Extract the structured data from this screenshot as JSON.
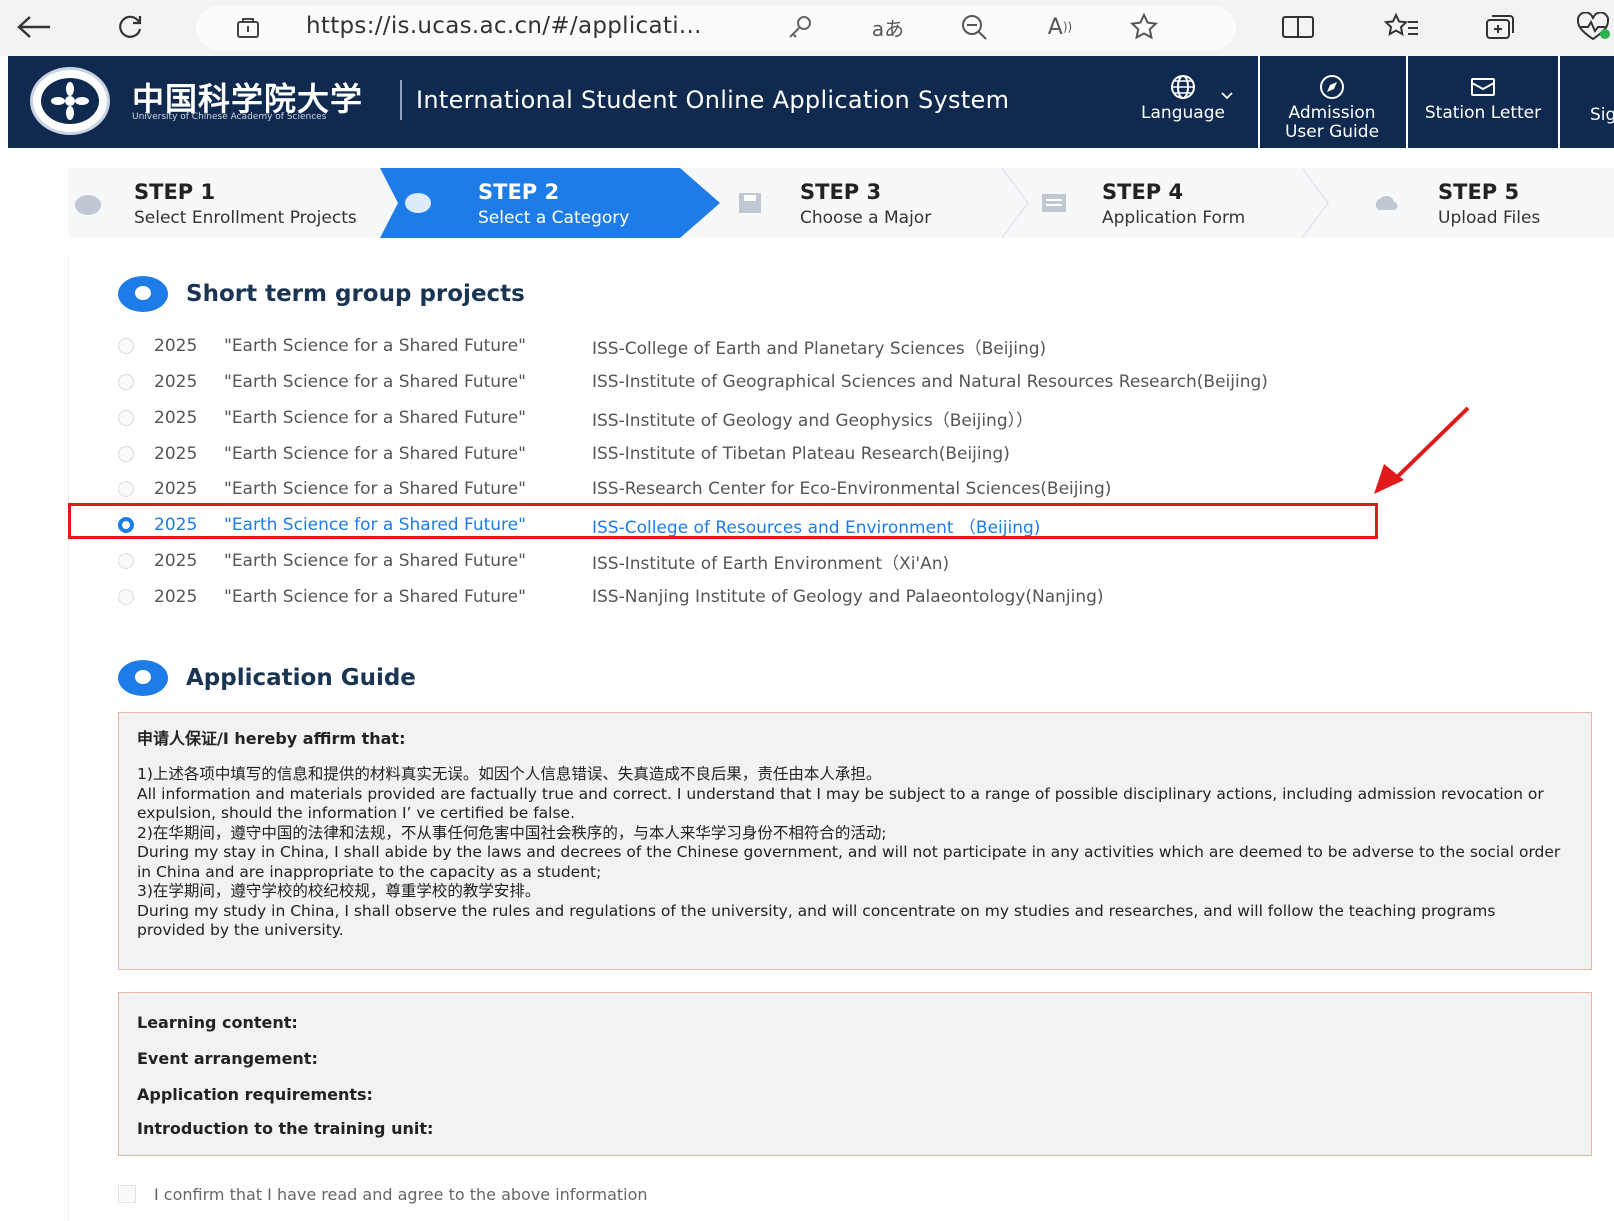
{
  "browser": {
    "url": "https://is.ucas.ac.cn/#/applicati...",
    "icons": [
      "back-icon",
      "refresh-icon",
      "site-info-icon",
      "key-icon",
      "translate-icon",
      "zoom-out-icon",
      "read-aloud-icon",
      "favorite-icon",
      "split-screen-icon",
      "favorites-list-icon",
      "collections-icon",
      "performance-icon"
    ]
  },
  "header": {
    "logo_text": "中国科学院大学",
    "logo_sub": "University of Chinese Academy of Sciences",
    "system_title": "International Student Online Application System",
    "language_label": "Language",
    "guide_label_1": "Admission",
    "guide_label_2": "User Guide",
    "letter_label": "Station Letter",
    "signout_label": "Sig"
  },
  "steps": [
    {
      "title": "STEP 1",
      "subtitle": "Select Enrollment Projects"
    },
    {
      "title": "STEP 2",
      "subtitle": "Select a Category"
    },
    {
      "title": "STEP 3",
      "subtitle": "Choose a Major"
    },
    {
      "title": "STEP 4",
      "subtitle": "Application Form"
    },
    {
      "title": "STEP 5",
      "subtitle": "Upload Files"
    }
  ],
  "projects_section": {
    "title": "Short term group projects",
    "items": [
      {
        "year": "2025",
        "name": "\"Earth Science for a Shared Future\"",
        "unit": "ISS-College of Earth and Planetary Sciences（Beijing)",
        "selected": false
      },
      {
        "year": "2025",
        "name": "\"Earth Science for a Shared Future\"",
        "unit": "ISS-Institute of Geographical Sciences and Natural Resources Research(Beijing)",
        "selected": false
      },
      {
        "year": "2025",
        "name": "\"Earth Science for a Shared Future\"",
        "unit": "ISS-Institute of Geology and Geophysics（Beijing））",
        "selected": false
      },
      {
        "year": "2025",
        "name": "\"Earth Science for a Shared Future\"",
        "unit": "ISS-Institute of Tibetan Plateau Research(Beijing)",
        "selected": false
      },
      {
        "year": "2025",
        "name": "\"Earth Science for a Shared Future\"",
        "unit": "ISS-Research Center for Eco-Environmental Sciences(Beijing)",
        "selected": false
      },
      {
        "year": "2025",
        "name": "\"Earth Science for a Shared Future\"",
        "unit": "ISS-College of Resources and Environment （Beijing)",
        "selected": true
      },
      {
        "year": "2025",
        "name": "\"Earth Science for a Shared Future\"",
        "unit": "ISS-Institute of Earth Environment（Xi'An)",
        "selected": false
      },
      {
        "year": "2025",
        "name": "\"Earth Science for a Shared Future\"",
        "unit": "ISS-Nanjing Institute of Geology and Palaeontology(Nanjing)",
        "selected": false
      }
    ]
  },
  "guide_section": {
    "title": "Application Guide",
    "affirm_heading": "申请人保证/I hereby affirm that:",
    "paragraphs": [
      "1)上述各项中填写的信息和提供的材料真实无误。如因个人信息错误、失真造成不良后果，责任由本人承担。",
      "All information and materials provided are factually true and correct. I understand that I may be subject to a range of possible disciplinary actions, including admission revocation or expulsion, should the information I’ ve certified be false.",
      "2)在华期间，遵守中国的法律和法规，不从事任何危害中国社会秩序的，与本人来华学习身份不相符合的活动;",
      "During my stay in China, I shall abide by the laws and decrees of the Chinese government, and will not participate in any activities which are deemed to be adverse to the social order in China and are inappropriate to the capacity as a student;",
      "3)在学期间，遵守学校的校纪校规，尊重学校的教学安排。",
      " During my study in China, I shall observe the rules and regulations of the university, and will concentrate on my studies and researches, and will follow the teaching programs provided by the university."
    ],
    "info_lines": [
      "Learning content:",
      "Event arrangement:",
      "Application requirements:",
      "Introduction to the training unit:"
    ],
    "confirm_text": "I confirm that I have read and agree to the above information"
  },
  "colors": {
    "header_bg": "#0f2a4e",
    "accent": "#1e7ce8",
    "highlight": "#e01a1a",
    "arrow": "#e01a1a"
  }
}
